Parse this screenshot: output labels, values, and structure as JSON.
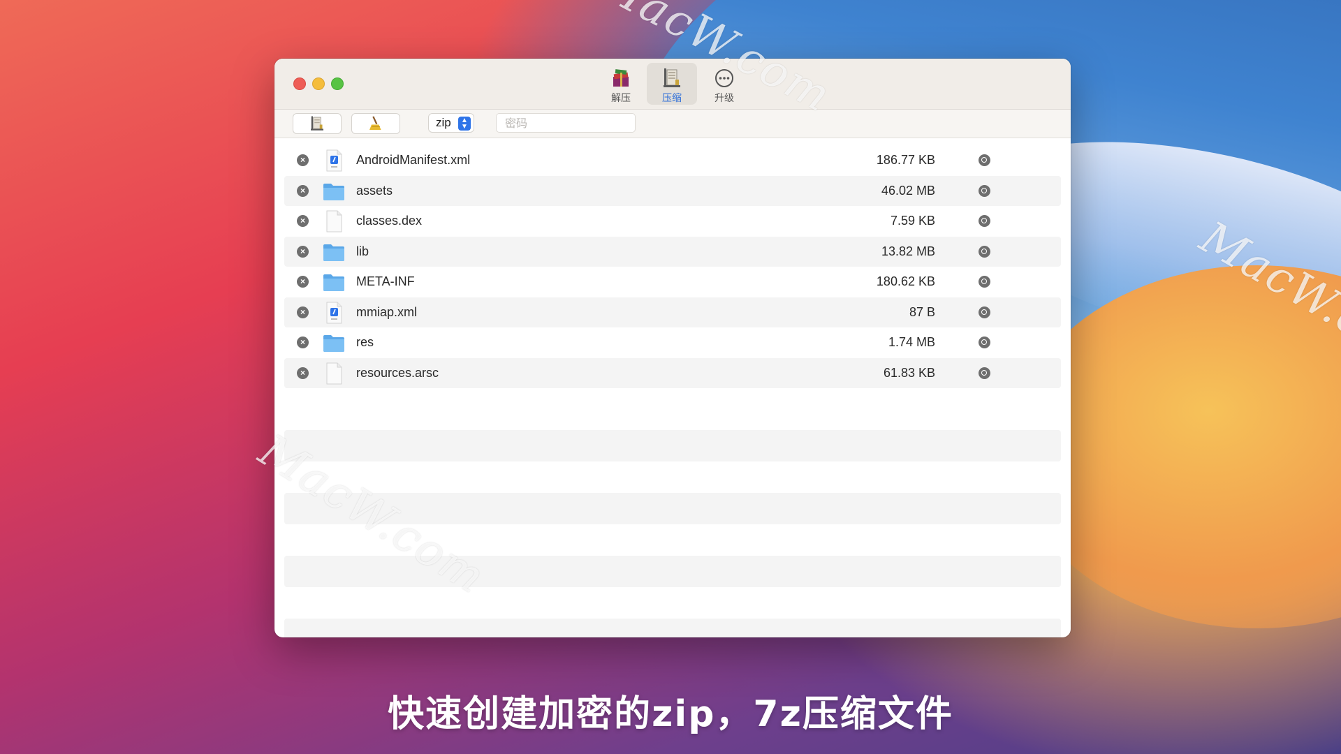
{
  "toolbar_tabs": [
    {
      "label": "解压",
      "icon": "archive-books-icon",
      "active": false
    },
    {
      "label": "压缩",
      "icon": "compress-clamp-icon",
      "active": true
    },
    {
      "label": "升级",
      "icon": "more-ellipsis-icon",
      "active": false
    }
  ],
  "controls": {
    "add_icon": "add-files-icon",
    "clean_icon": "broom-icon",
    "format_value": "zip",
    "password_placeholder": "密码"
  },
  "files": [
    {
      "name": "AndroidManifest.xml",
      "size": "186.77 KB",
      "type": "xml"
    },
    {
      "name": "assets",
      "size": "46.02 MB",
      "type": "folder"
    },
    {
      "name": "classes.dex",
      "size": "7.59 KB",
      "type": "file"
    },
    {
      "name": "lib",
      "size": "13.82 MB",
      "type": "folder"
    },
    {
      "name": "META-INF",
      "size": "180.62 KB",
      "type": "folder"
    },
    {
      "name": "mmiap.xml",
      "size": "87 B",
      "type": "xml"
    },
    {
      "name": "res",
      "size": "1.74 MB",
      "type": "folder"
    },
    {
      "name": "resources.arsc",
      "size": "61.83 KB",
      "type": "file"
    }
  ],
  "watermark": "MacW.com",
  "caption": "快速创建加密的zip，7z压缩文件",
  "colors": {
    "accent": "#2f74e8",
    "close": "#ee5d56",
    "minimize": "#f5bd3b",
    "maximize": "#58c344",
    "folder": "#6cb6f0"
  }
}
